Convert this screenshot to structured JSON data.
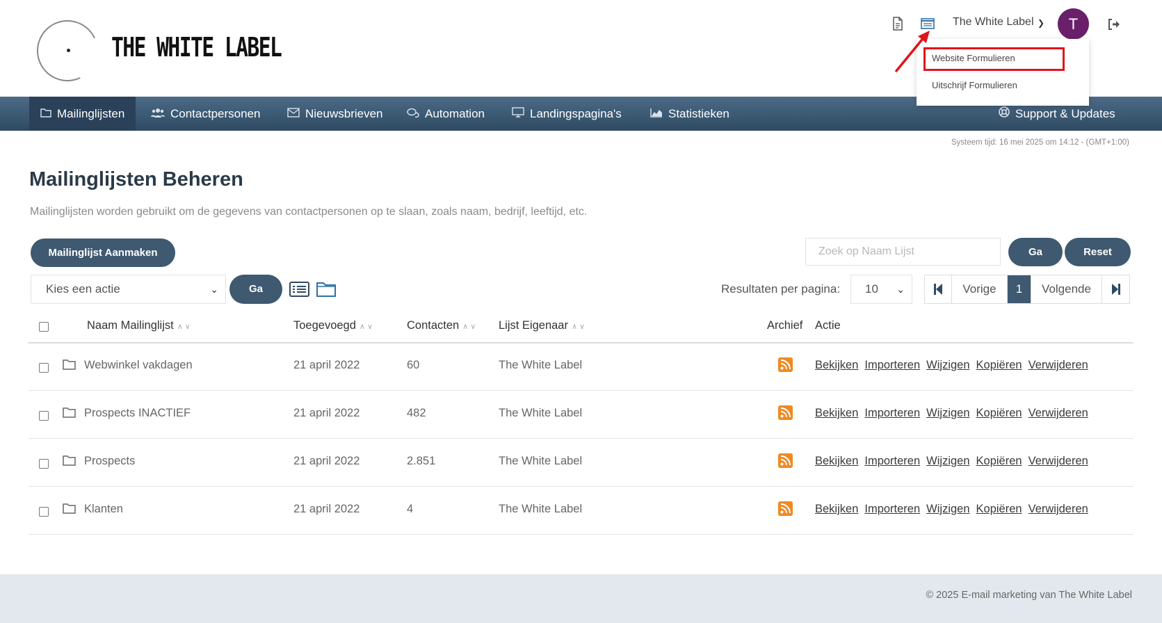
{
  "header": {
    "logo_text": "THE WHITE LABEL",
    "user_name": "The White Label",
    "avatar_initial": "T",
    "icons": [
      "document-icon",
      "form-icon",
      "logout-icon"
    ],
    "dropdown": [
      "Website Formulieren",
      "Uitschrijf Formulieren"
    ],
    "highlight_color": "#e0141a"
  },
  "nav": {
    "items": [
      {
        "label": "Mailinglijsten",
        "icon": "folder-icon"
      },
      {
        "label": "Contactpersonen",
        "icon": "users-icon"
      },
      {
        "label": "Nieuwsbrieven",
        "icon": "envelope-icon"
      },
      {
        "label": "Automation",
        "icon": "chat-icon"
      },
      {
        "label": "Landingspagina's",
        "icon": "monitor-icon"
      },
      {
        "label": "Statistieken",
        "icon": "chart-icon"
      }
    ],
    "support": {
      "label": "Support & Updates",
      "icon": "lifebuoy-icon"
    }
  },
  "system_time": "Systeem tijd: 16 mei 2025 om 14:12 - (GMT+1:00)",
  "page": {
    "title": "Mailinglijsten Beheren",
    "description": "Mailinglijsten worden gebruikt om de gegevens van contactpersonen op te slaan, zoals naam, bedrijf, leeftijd, etc."
  },
  "toolbar": {
    "create_label": "Mailinglijst Aanmaken",
    "search_placeholder": "Zoek op Naam Lijst",
    "go_label": "Ga",
    "reset_label": "Reset",
    "action_select": "Kies een actie",
    "action_go_label": "Ga",
    "results_per_page_label": "Resultaten per pagina:",
    "results_per_page": "10",
    "prev_label": "Vorige",
    "current_page": "1",
    "next_label": "Volgende"
  },
  "table": {
    "headers": {
      "name": "Naam Mailinglijst",
      "added": "Toegevoegd",
      "contacts": "Contacten",
      "owner": "Lijst Eigenaar",
      "archive": "Archief",
      "action": "Actie"
    },
    "rows": [
      {
        "name": "Webwinkel vakdagen",
        "added": "21 april 2022",
        "contacts": "60",
        "owner": "The White Label"
      },
      {
        "name": "Prospects INACTIEF",
        "added": "21 april 2022",
        "contacts": "482",
        "owner": "The White Label"
      },
      {
        "name": "Prospects",
        "added": "21 april 2022",
        "contacts": "2.851",
        "owner": "The White Label"
      },
      {
        "name": "Klanten",
        "added": "21 april 2022",
        "contacts": "4",
        "owner": "The White Label"
      }
    ],
    "actions": [
      "Bekijken",
      "Importeren",
      "Wijzigen",
      "Kopiëren",
      "Verwijderen"
    ]
  },
  "footer": "© 2025 E-mail marketing van The White Label"
}
